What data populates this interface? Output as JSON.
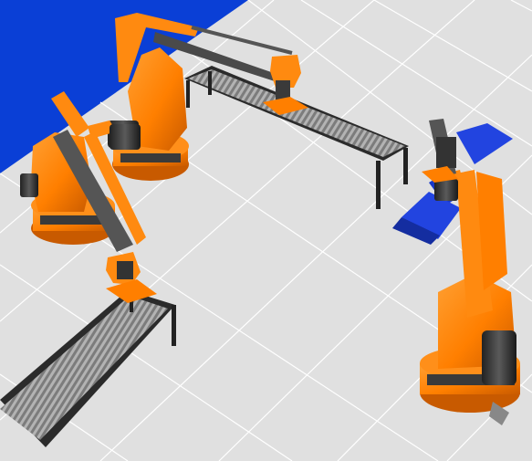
{
  "viewport": {
    "scene": "3d-simulation-viewport",
    "colors": {
      "backdrop_wall": "#0a3fd6",
      "floor": "#d9d9d9",
      "floor_grid": "#ffffff",
      "robot_orange": "#ff7f00",
      "robot_dark": "#3a3a3a",
      "conveyor_frame": "#2b2b2b",
      "conveyor_rollers": "#8e8e8e",
      "pallet_blue": "#1f3fd8"
    },
    "objects": [
      {
        "kind": "robot-arm",
        "name": "robot-arm-left"
      },
      {
        "kind": "robot-arm",
        "name": "robot-arm-back"
      },
      {
        "kind": "robot-arm",
        "name": "robot-arm-right"
      },
      {
        "kind": "conveyor",
        "name": "conveyor-back"
      },
      {
        "kind": "conveyor",
        "name": "conveyor-front"
      },
      {
        "kind": "pallet",
        "name": "pallet-blue"
      }
    ]
  }
}
